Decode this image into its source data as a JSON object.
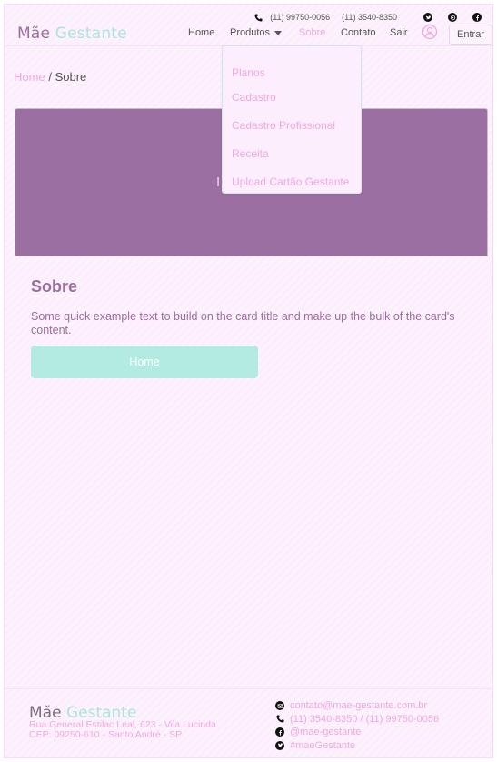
{
  "topbar": {
    "phone1": "(11) 99750-0056",
    "phone2": "(11) 3540-8350",
    "social": [
      "twitter-icon",
      "whatsapp-icon",
      "facebook-icon"
    ]
  },
  "brand": {
    "part1": "Mãe",
    "part2": "Gestante"
  },
  "nav": {
    "home": "Home",
    "produtos": "Produtos",
    "sobre": "Sobre",
    "contato": "Contato",
    "sair": "Sair",
    "entrar": "Entrar"
  },
  "dropdown": {
    "items": [
      "Planos",
      "Cadastro",
      "Cadastro Profissional",
      "Receita",
      "Upload Cartão Gestante"
    ]
  },
  "breadcrumb": {
    "home": "Home",
    "sep": "/",
    "current": "Sobre"
  },
  "hero": {
    "label": "I"
  },
  "card": {
    "title": "Sobre",
    "text": "Some quick example text to build on the card title and make up the bulk of the card's content.",
    "button": "Home"
  },
  "footer": {
    "brand_part1": "Mãe",
    "brand_part2": "Gestante",
    "address_line1": "Rua General Estilac Leal, 623 - Vila Lucinda",
    "address_line2": "CEP: 09250-610 - Santo André - SP",
    "email": "contato@mae-gestante.com.br",
    "phones": "(11) 3540-8350 / (11) 99750-0056",
    "facebook": "@mae-gestante",
    "twitter": "#maeGestante"
  },
  "colors": {
    "background": "#fdeefd",
    "brand_purple": "#9a6e9e",
    "brand_mint": "#a8e6dc",
    "accent_pink": "#f1a8df",
    "hero": "#9c6fa2"
  }
}
